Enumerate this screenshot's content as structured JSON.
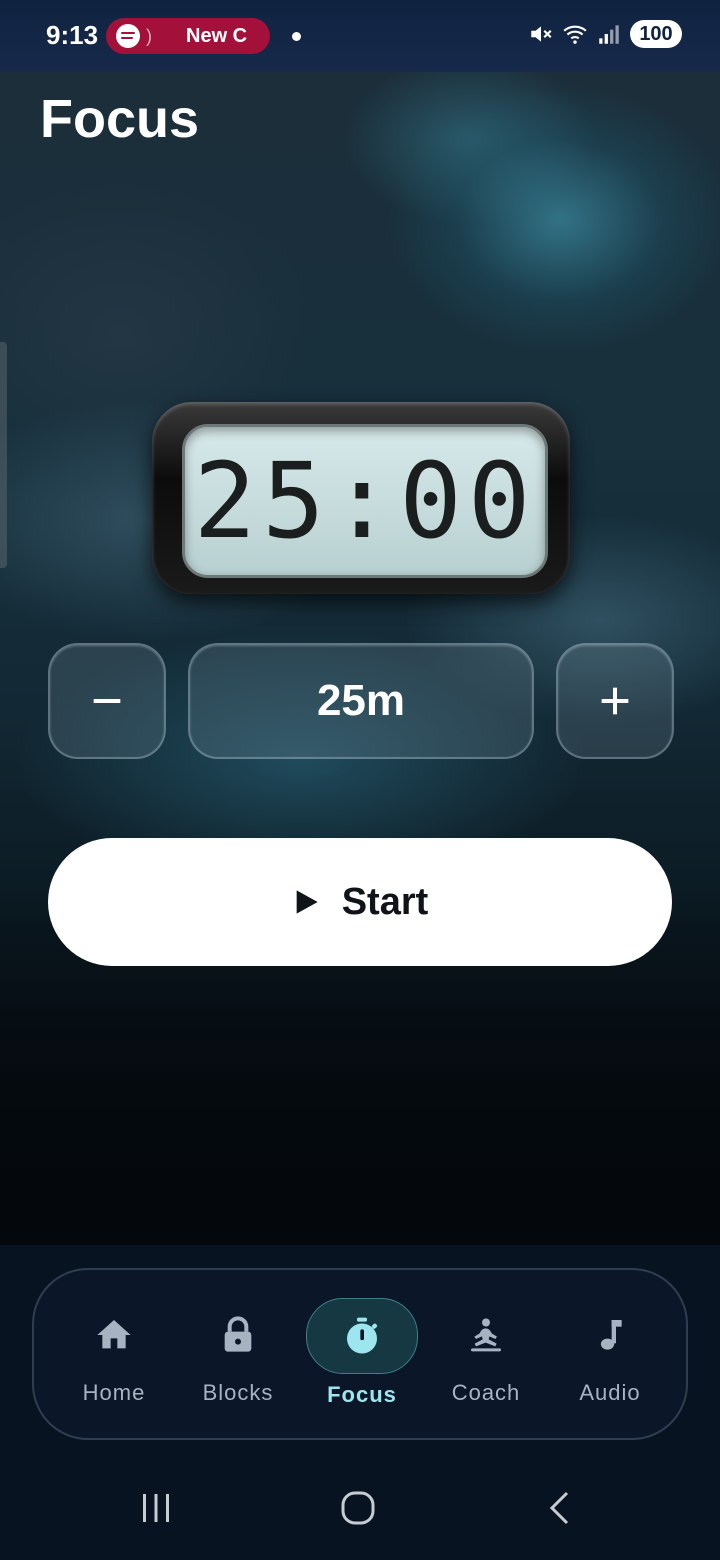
{
  "status_bar": {
    "time": "9:13",
    "media_title": "New C",
    "battery": "100",
    "icons": [
      "spotify-icon",
      "mute-icon",
      "wifi-icon",
      "signal-icon"
    ]
  },
  "header": {
    "title": "Focus"
  },
  "timer": {
    "display": "25:00"
  },
  "duration": {
    "value_label": "25m"
  },
  "start_button": {
    "label": "Start"
  },
  "bottom_nav": {
    "items": [
      {
        "label": "Home",
        "icon": "home-icon",
        "active": false
      },
      {
        "label": "Blocks",
        "icon": "lock-icon",
        "active": false
      },
      {
        "label": "Focus",
        "icon": "timer-icon",
        "active": true
      },
      {
        "label": "Coach",
        "icon": "meditation-icon",
        "active": false
      },
      {
        "label": "Audio",
        "icon": "music-note-icon",
        "active": false
      }
    ]
  },
  "colors": {
    "accent": "#9ee6ef",
    "active_nav_bg": "#153843",
    "media_pill": "#a3103a",
    "nav_inactive": "#a7b3c1"
  }
}
